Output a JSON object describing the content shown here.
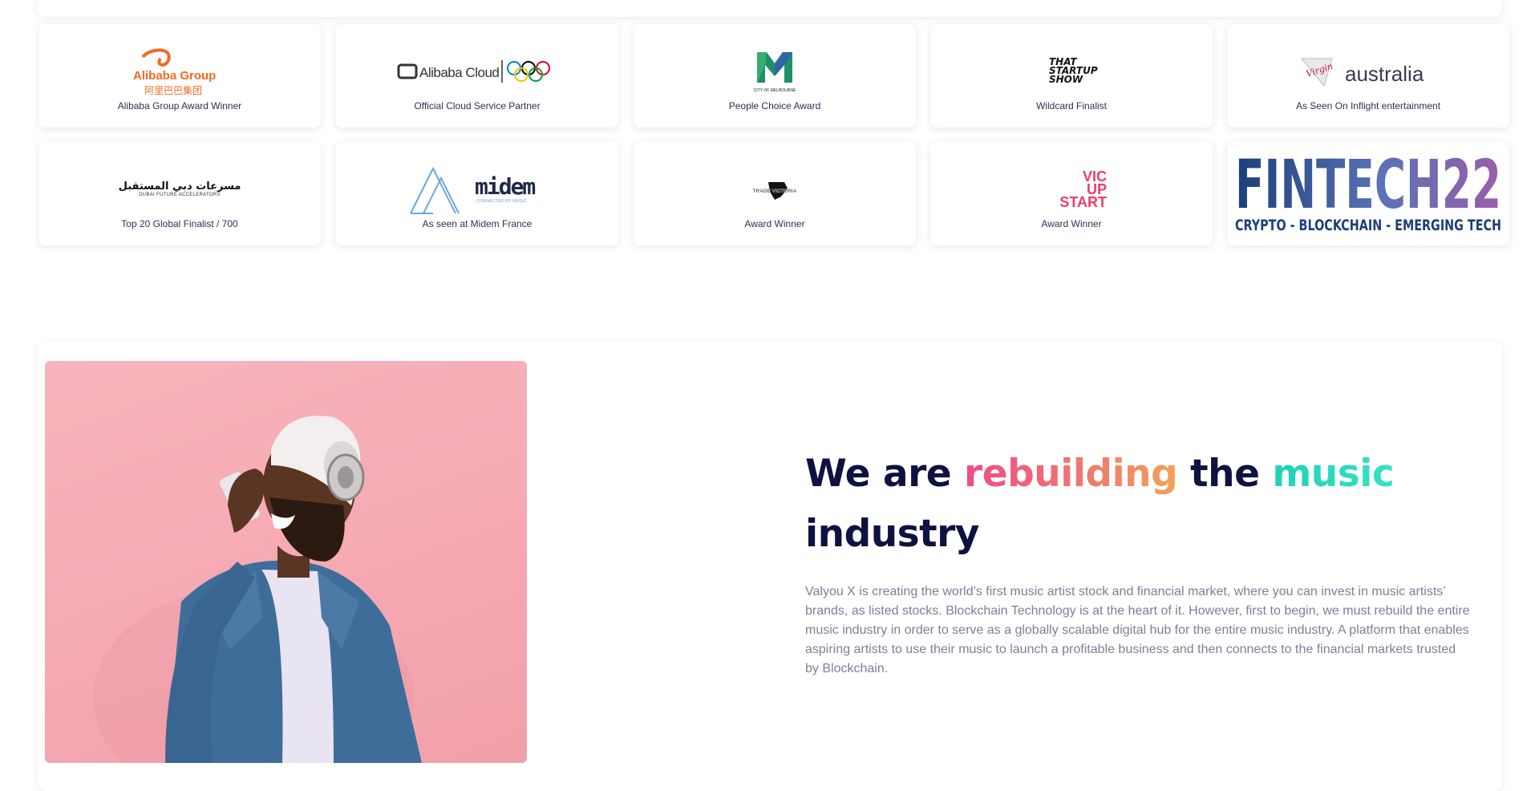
{
  "awards": [
    {
      "logo_text": "Alibaba Group",
      "logo_subtext": "阿里巴巴集团",
      "caption": "Alibaba Group Award Winner"
    },
    {
      "logo_text": "Alibaba Cloud",
      "caption": "Official Cloud Service Partner"
    },
    {
      "logo_text": "CITY OF MELBOURNE",
      "caption": "People Choice Award"
    },
    {
      "logo_text": "THAT STARTUP SHOW",
      "caption": "Wildcard Finalist"
    },
    {
      "logo_text": "australia",
      "logo_subtext": "Virgin",
      "caption": "As Seen On Inflight entertainment"
    },
    {
      "logo_text": "مسرعات دبي المستقبل",
      "logo_subtext": "DUBAI FUTURE ACCELERATORS",
      "caption": "Top 20 Global Finalist / 700"
    },
    {
      "logo_text": "midem",
      "logo_subtext": "CONNECTED BY MUSIC",
      "caption": "As seen at Midem France"
    },
    {
      "logo_text": "TRADE VICTORIA",
      "caption": "Award Winner"
    },
    {
      "logo_text": "VIC UP START",
      "caption": "Award Winner"
    },
    {
      "logo_text": "FINTECH22",
      "logo_subtext": "CRYPTO - BLOCKCHAIN - EMERGING TECH"
    }
  ],
  "about": {
    "headline_part1": "We are ",
    "headline_highlight1": "rebuilding",
    "headline_part2": " the ",
    "headline_highlight2": "music",
    "headline_part3": "industry",
    "body": "Valyou X is creating the world’s first music artist stock and financial market, where you can invest in music artists’ brands, as listed stocks. Blockchain Technology is at the heart of it. However, first to begin, we must rebuild the entire music industry in order to serve as a globally scalable digital hub for the entire music industry. A platform that enables aspiring artists to use their music to launch a profitable business and then connects to the financial markets trusted by Blockchain."
  },
  "colors": {
    "headline": "#0e1240",
    "highlight_pink": "#ef4b8a",
    "highlight_orange": "#f4a257",
    "highlight_teal": "#21d1b8",
    "hero_background": "#f6a9b3"
  },
  "icons": [
    "alibaba-logo-icon",
    "olympic-rings-icon",
    "melbourne-m-icon",
    "virgin-icon",
    "midem-mountain-icon",
    "victoria-map-icon",
    "person-singing-image"
  ]
}
